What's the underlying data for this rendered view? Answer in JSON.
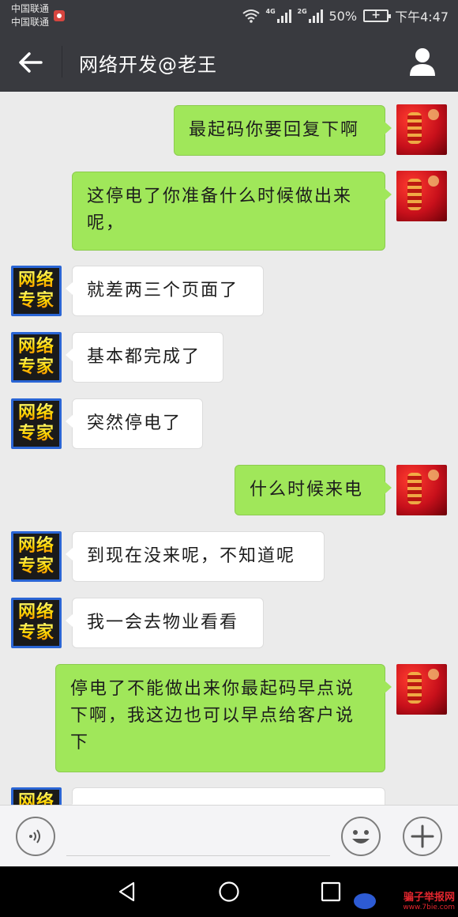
{
  "status_bar": {
    "carrier_1": "中国联通",
    "carrier_2": "中国联通",
    "network_1": "4G",
    "network_2": "2G",
    "battery_percent": "50%",
    "time": "下午4:47",
    "icons": [
      "record-icon",
      "wifi-icon",
      "signal-icon",
      "signal-icon",
      "battery-charging-icon"
    ]
  },
  "header": {
    "title": "网络开发@老王",
    "back_icon": "arrow-left-icon",
    "profile_icon": "person-icon"
  },
  "contact_avatar": {
    "line_1": "网络",
    "line_2": "专家"
  },
  "messages": [
    {
      "side": "right",
      "text": "最起码你要回复下啊"
    },
    {
      "side": "right",
      "text": "这停电了你准备什么时候做出来呢，"
    },
    {
      "side": "left",
      "text": "就差两三个页面了"
    },
    {
      "side": "left",
      "text": "基本都完成了"
    },
    {
      "side": "left",
      "text": "突然停电了"
    },
    {
      "side": "right",
      "text": "什么时候来电"
    },
    {
      "side": "left",
      "text": "到现在没来呢，不知道呢"
    },
    {
      "side": "left",
      "text": "我一会去物业看看"
    },
    {
      "side": "right",
      "text": "停电了不能做出来你最起码早点说下啊，我这边也可以早点给客户说下"
    },
    {
      "side": "left",
      "text": ""
    }
  ],
  "input_bar": {
    "voice_icon": "voice-icon",
    "emoji_icon": "smiley-icon",
    "more_icon": "plus-icon"
  },
  "system_nav": {
    "icons": [
      "triangle-back-icon",
      "circle-home-icon",
      "square-recent-icon"
    ]
  },
  "watermark": {
    "main": "骗子举报网",
    "sub": "www.7bie.com"
  },
  "colors": {
    "header_bg": "#393a3f",
    "chat_bg": "#ebebeb",
    "sent_bubble": "#a0e75a",
    "received_bubble": "#ffffff"
  }
}
